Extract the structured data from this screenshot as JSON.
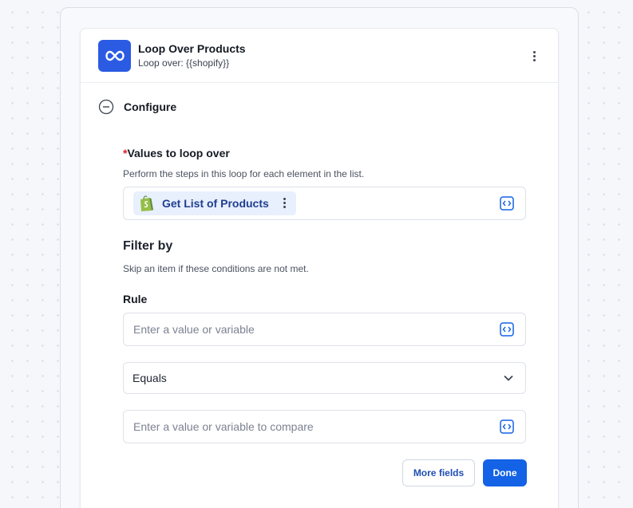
{
  "step": {
    "title": "Loop Over Products",
    "subtitle": "Loop over: {{shopify}}",
    "icon": "infinity-icon",
    "icon_color": "#2b5be3"
  },
  "section": {
    "title": "Configure",
    "toggle_icon": "minus-circle-icon"
  },
  "values_field": {
    "required_marker": "*",
    "label": "Values to loop over",
    "help": "Perform the steps in this loop for each element in the list.",
    "chip": {
      "label": "Get List of Products",
      "icon": "shopify-bag-icon"
    }
  },
  "filter": {
    "heading": "Filter by",
    "help": "Skip an item if these conditions are not met.",
    "rule_label": "Rule",
    "value_placeholder": "Enter a value or variable",
    "operator": "Equals",
    "compare_placeholder": "Enter a value or variable to compare"
  },
  "actions": {
    "more_fields": "More fields",
    "done": "Done"
  },
  "colors": {
    "primary": "#1462e6",
    "required": "#e11d2a",
    "chip_bg": "#e8effd"
  }
}
